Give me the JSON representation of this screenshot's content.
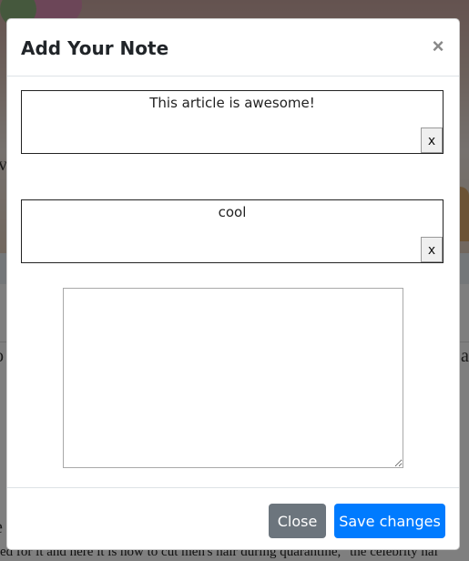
{
  "background": {
    "caption_fragment": "ed for it and here it is how to cut men's hair during quarantine,\" the celebrity hai"
  },
  "modal": {
    "title": "Add Your Note",
    "close_icon": "×",
    "notes": [
      {
        "text": "This article is awesome!",
        "delete_label": "x"
      },
      {
        "text": "cool",
        "delete_label": "x"
      }
    ],
    "new_note": {
      "value": "",
      "placeholder": ""
    },
    "footer": {
      "close_label": "Close",
      "save_label": "Save changes"
    },
    "colors": {
      "close_button": "#6c757d",
      "save_button": "#007bff"
    }
  }
}
